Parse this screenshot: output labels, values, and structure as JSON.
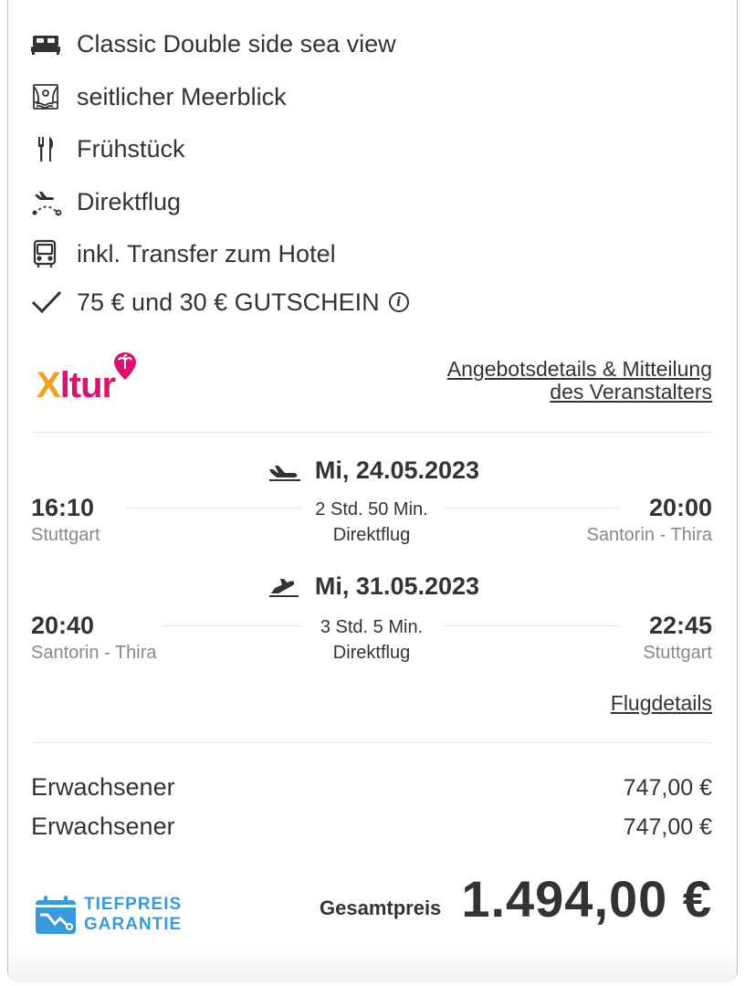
{
  "features": [
    {
      "icon": "bed-icon",
      "label": "Classic Double side sea view"
    },
    {
      "icon": "sea-view-icon",
      "label": "seitlicher Meerblick"
    },
    {
      "icon": "cutlery-icon",
      "label": "Frühstück"
    },
    {
      "icon": "direct-flight-icon",
      "label": "Direktflug"
    },
    {
      "icon": "bus-icon",
      "label": "inkl. Transfer zum Hotel"
    },
    {
      "icon": "checkmark-icon",
      "label": "75 € und 30 € GUTSCHEIN"
    }
  ],
  "operator": {
    "logo_text_x": "X",
    "logo_text_rest": "ltur",
    "details_link_line1": "Angebotsdetails & Mitteilung",
    "details_link_line2": "des Veranstalters"
  },
  "flights": [
    {
      "direction": "outbound",
      "date": "Mi, 24.05.2023",
      "depart_time": "16:10",
      "depart_city": "Stuttgart",
      "duration": "2 Std. 50 Min.",
      "type": "Direktflug",
      "arrive_time": "20:00",
      "arrive_city": "Santorin - Thira"
    },
    {
      "direction": "return",
      "date": "Mi, 31.05.2023",
      "depart_time": "20:40",
      "depart_city": "Santorin - Thira",
      "duration": "3 Std. 5 Min.",
      "type": "Direktflug",
      "arrive_time": "22:45",
      "arrive_city": "Stuttgart"
    }
  ],
  "flight_details_link": "Flugdetails",
  "prices": [
    {
      "label": "Erwachsener",
      "value": "747,00 €"
    },
    {
      "label": "Erwachsener",
      "value": "747,00 €"
    }
  ],
  "total": {
    "label": "Gesamtpreis",
    "value": "1.494,00 €"
  },
  "badge": {
    "line1": "TIEFPREIS",
    "line2": "GARANTIE"
  },
  "colors": {
    "brand_orange": "#f29f1f",
    "brand_pink": "#d7156f",
    "badge_blue": "#3a9ad9",
    "text": "#333333"
  }
}
